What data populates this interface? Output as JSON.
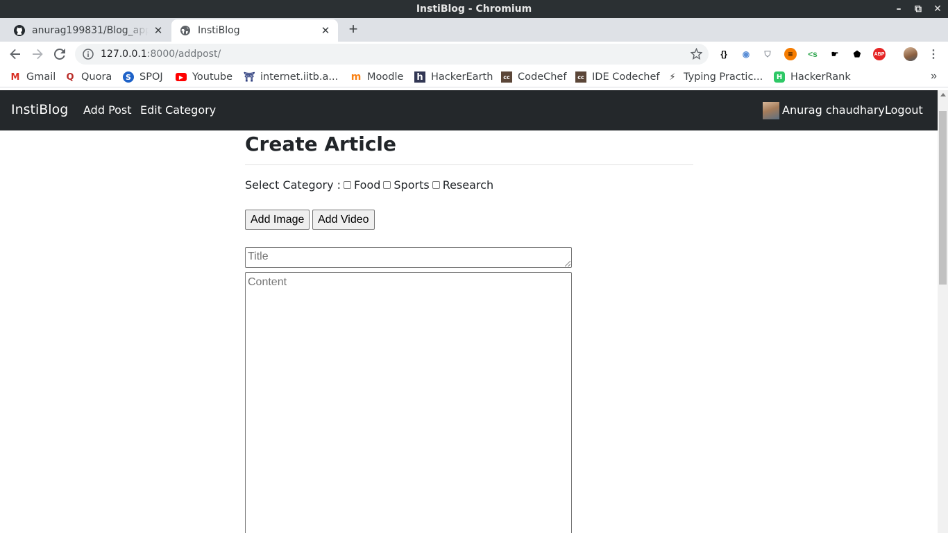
{
  "window": {
    "title": "InstiBlog - Chromium",
    "controls": {
      "minimize": "–",
      "maximize": "⧉",
      "close": "✕"
    }
  },
  "tabs": [
    {
      "label": "anurag199831/Blog_app: ",
      "icon": "github-icon",
      "close": "✕"
    },
    {
      "label": "InstiBlog",
      "icon": "globe-icon",
      "close": "✕"
    }
  ],
  "new_tab": "+",
  "address_bar": {
    "host": "127.0.0.1",
    "path": ":8000/addpost/"
  },
  "extensions": [
    {
      "name": "braces-extension-icon",
      "glyph": "{}",
      "color": "#000000"
    },
    {
      "name": "glasses-extension-icon",
      "glyph": "◉",
      "color": "#5a8ed6"
    },
    {
      "name": "shield-extension-icon",
      "glyph": "⛉",
      "color": "#8a9099"
    },
    {
      "name": "hamburger-extension-icon",
      "glyph": "≡",
      "color": "#f57c00"
    },
    {
      "name": "code-extension-icon",
      "glyph": "<s",
      "color": "#34a853"
    },
    {
      "name": "foot-extension-icon",
      "glyph": "☛",
      "color": "#000000"
    },
    {
      "name": "boot-extension-icon",
      "glyph": "⬟",
      "color": "#000000"
    },
    {
      "name": "adblock-extension-icon",
      "glyph": "ABP",
      "color": "#e52525"
    }
  ],
  "bookmarks": [
    {
      "label": "Gmail",
      "icon": "gmail-icon",
      "glyph": "M",
      "color": "#d93025"
    },
    {
      "label": "Quora",
      "icon": "quora-icon",
      "glyph": "Q",
      "color": "#b92b27"
    },
    {
      "label": "SPOJ",
      "icon": "spoj-icon",
      "glyph": "S",
      "color": "#1e62c8"
    },
    {
      "label": "Youtube",
      "icon": "youtube-icon",
      "glyph": "▶",
      "color": "#ff0000"
    },
    {
      "label": "internet.iitb.a...",
      "icon": "iitb-icon",
      "glyph": "⛩",
      "color": "#2a3b7c"
    },
    {
      "label": "Moodle",
      "icon": "moodle-icon",
      "glyph": "m",
      "color": "#f98012"
    },
    {
      "label": "HackerEarth",
      "icon": "hackerearth-icon",
      "glyph": "h",
      "color": "#323754"
    },
    {
      "label": "CodeChef",
      "icon": "codechef-icon",
      "glyph": "cc",
      "color": "#5b4638"
    },
    {
      "label": "IDE Codechef",
      "icon": "codechef-ide-icon",
      "glyph": "cc",
      "color": "#5b4638"
    },
    {
      "label": "Typing Practic...",
      "icon": "lightning-icon",
      "glyph": "⚡",
      "color": "#333333"
    },
    {
      "label": "HackerRank",
      "icon": "hackerrank-icon",
      "glyph": "H",
      "color": "#2ec866"
    }
  ],
  "bookmarks_more": "»",
  "site": {
    "brand": "InstiBlog",
    "nav": {
      "add_post": "Add Post",
      "edit_category": "Edit Category"
    },
    "user": "Anurag chaudhary",
    "logout": "Logout"
  },
  "form": {
    "heading": "Create Article",
    "category_label": "Select Category :",
    "categories": [
      "Food",
      "Sports",
      "Research"
    ],
    "add_image": "Add Image",
    "add_video": "Add Video",
    "title_placeholder": "Title",
    "content_placeholder": "Content"
  },
  "colors": {
    "site_nav_bg": "#24282b",
    "titlebar_bg": "#2b3033",
    "tabstrip_bg": "#dee1e6"
  }
}
